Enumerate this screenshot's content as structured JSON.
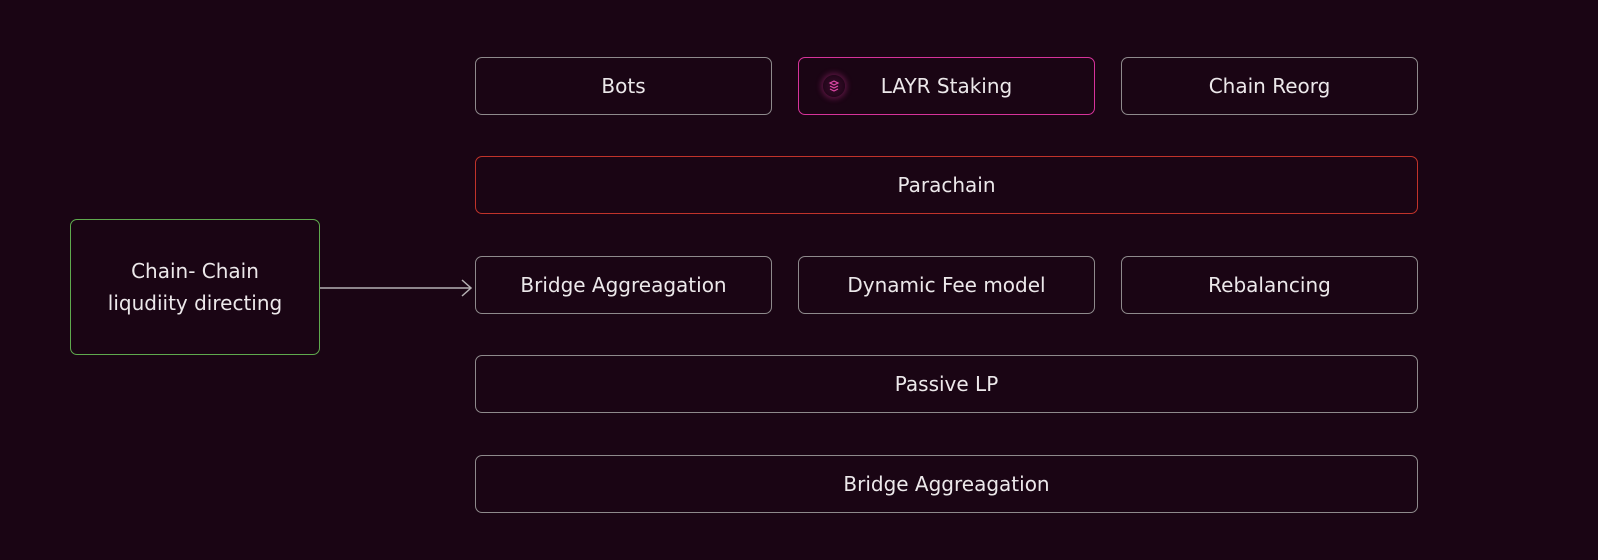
{
  "diagram": {
    "source_node": {
      "label": "Chain- Chain liqudiity directing"
    },
    "row1": [
      {
        "label": "Bots"
      },
      {
        "label": "LAYR Staking",
        "icon": "layr-token-icon"
      },
      {
        "label": "Chain Reorg"
      }
    ],
    "parachain": {
      "label": "Parachain"
    },
    "row3": [
      {
        "label": "Bridge Aggreagation"
      },
      {
        "label": "Dynamic Fee model"
      },
      {
        "label": "Rebalancing"
      }
    ],
    "passive_lp": {
      "label": "Passive LP"
    },
    "bottom": {
      "label": "Bridge Aggreagation"
    }
  },
  "colors": {
    "background": "#1a0514",
    "default_border": "#8e8a8c",
    "highlight_border": "#d6339a",
    "parachain_border": "#c0332a",
    "source_border": "#5faa4e",
    "text": "#ece8ea",
    "arrow": "#b5b1b3"
  }
}
